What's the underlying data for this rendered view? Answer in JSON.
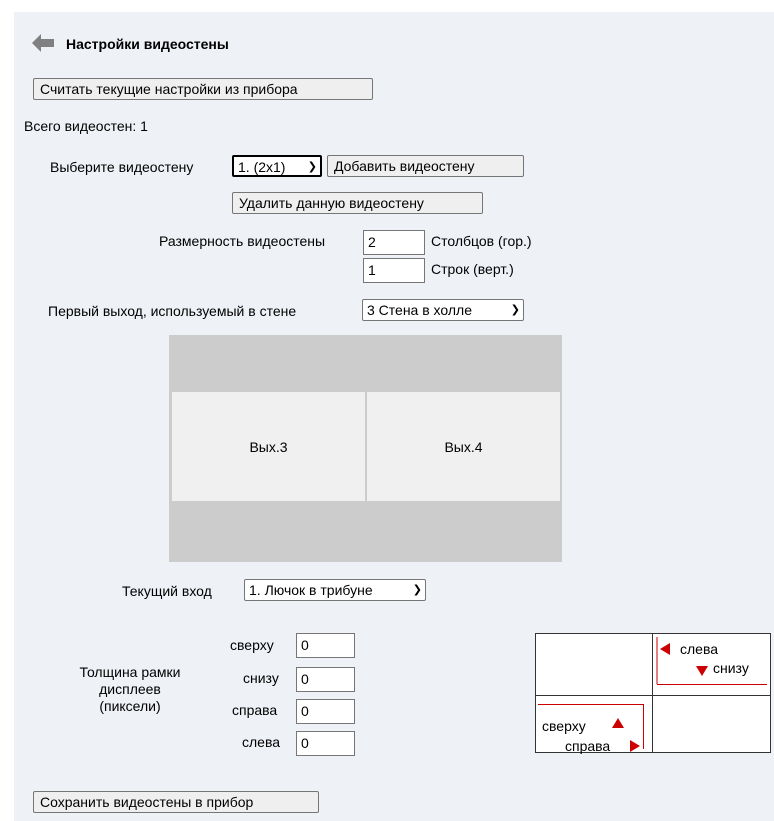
{
  "header": {
    "title": "Настройки видеостены",
    "back_icon": "back-arrow-icon"
  },
  "buttons": {
    "read_settings": "Считать текущие настройки из прибора",
    "add_wall": "Добавить видеостену",
    "delete_wall": "Удалить данную видеостену",
    "save_walls": "Сохранить видеостены в прибор"
  },
  "total_walls": "Всего видеостен: 1",
  "select_wall": {
    "label": "Выберите видеостену",
    "value": "1. (2x1)"
  },
  "dimensions": {
    "label": "Размерность видеостены",
    "columns_value": "2",
    "columns_label": "Столбцов (гор.)",
    "rows_value": "1",
    "rows_label": "Строк (верт.)"
  },
  "first_output": {
    "label": "Первый выход, используемый в стене",
    "value": "3 Стена в холле"
  },
  "layout": {
    "cells": [
      "Вых.3",
      "Вых.4"
    ]
  },
  "current_input": {
    "label": "Текущий вход",
    "value": "1. Лючок в трибуне"
  },
  "bezel": {
    "label_line1": "Толщина рамки",
    "label_line2": "дисплеев",
    "label_line3": "(пиксели)",
    "top_label": "сверху",
    "top_value": "0",
    "bottom_label": "снизу",
    "bottom_value": "0",
    "right_label": "справа",
    "right_value": "0",
    "left_label": "слева",
    "left_value": "0"
  },
  "diagram": {
    "left_label": "слева",
    "bottom_label": "снизу",
    "top_label": "сверху",
    "right_label": "справа",
    "accent_color": "#cc0000"
  }
}
